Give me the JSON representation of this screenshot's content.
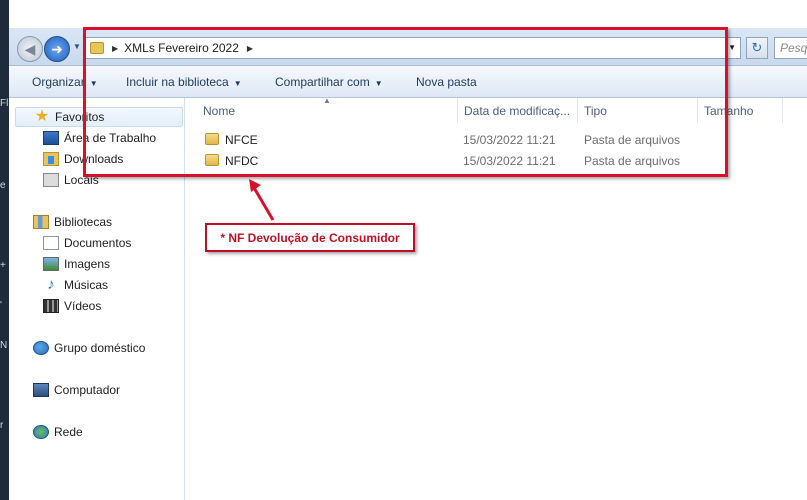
{
  "address": {
    "path": "XMLs Fevereiro 2022"
  },
  "search": {
    "placeholder": "Pesq"
  },
  "commands": {
    "organize": "Organizar",
    "include_library": "Incluir na biblioteca",
    "share": "Compartilhar com",
    "new_folder": "Nova pasta"
  },
  "nav": {
    "favorites": "Favoritos",
    "desktop": "Área de Trabalho",
    "downloads": "Downloads",
    "places": "Locais",
    "libraries": "Bibliotecas",
    "documents": "Documentos",
    "images": "Imagens",
    "music": "Músicas",
    "videos": "Vídeos",
    "homegroup": "Grupo doméstico",
    "computer": "Computador",
    "network": "Rede"
  },
  "columns": {
    "name": "Nome",
    "date": "Data de modificaç...",
    "type": "Tipo",
    "size": "Tamanho"
  },
  "files": [
    {
      "name": "NFCE",
      "date": "15/03/2022 11:21",
      "type": "Pasta de arquivos"
    },
    {
      "name": "NFDC",
      "date": "15/03/2022 11:21",
      "type": "Pasta de arquivos"
    }
  ],
  "annotation": {
    "callout_text": "* NF Devolução de Consumidor",
    "color": "#d9102a"
  }
}
